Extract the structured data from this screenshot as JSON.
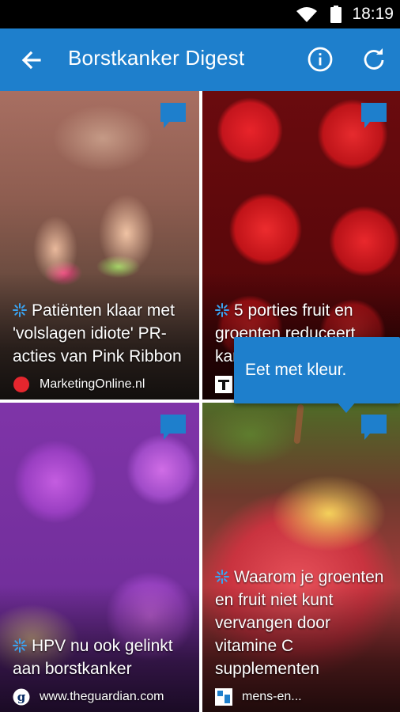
{
  "status_bar": {
    "time": "18:19",
    "icons": [
      "wifi-icon",
      "battery-icon"
    ]
  },
  "app_bar": {
    "title": "Borstkanker Digest",
    "back_icon": "arrow-left-icon",
    "info_icon": "info-icon",
    "refresh_icon": "refresh-icon",
    "color": "#1e7fcc"
  },
  "tooltip": {
    "text": "Eet met kleur."
  },
  "articles": [
    {
      "headline": "Patiënten klaar met 'volslagen idiote' PR-acties van Pink Ribbon",
      "source": "MarketingOnline.nl",
      "source_logo": "red-dot-logo"
    },
    {
      "headline": "5 porties fruit en groenten reduceert kans",
      "source": "",
      "source_logo": "telegraph-logo"
    },
    {
      "headline": "HPV nu ook gelinkt aan borstkanker",
      "source": "www.theguardian.com",
      "source_logo": "guardian-logo"
    },
    {
      "headline": "Waarom je groenten en fruit niet kunt vervangen door vitamine C supplementen",
      "source": "mens-en...",
      "source_logo": "mens-en-logo"
    }
  ],
  "colors": {
    "accent": "#1e7fcc",
    "spark": "#3aa3f0"
  }
}
